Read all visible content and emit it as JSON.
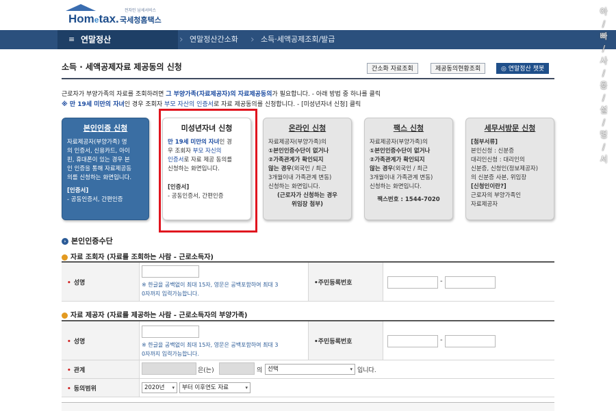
{
  "header": {
    "logo_brand": "Hom",
    "logo_e": "e",
    "logo_brand_end": "tax.",
    "logo_kr": "국세청홈택스",
    "logo_small": "전자민 남세서비스"
  },
  "nav": {
    "menu_icon": "≡",
    "main_label": "연말정산",
    "crumbs": [
      "연말정산간소화",
      "소득·세액공제조회/발급"
    ],
    "sep": "›"
  },
  "page": {
    "title": "소득 · 세액공제자료 제공동의 신청",
    "buttons": [
      "간소화 자료조회",
      "제공동의현황조회",
      "연말정산 챗봇"
    ],
    "intro1_a": "근로자가 부양가족의 자료를 조회하려면 ",
    "intro1_b": "그 부양가족(자료제공자)의 자료제공동의",
    "intro1_c": "가 필요합니다. - 아래 방법 중 하나를 클릭",
    "intro2_a": "※ 만 19세 미만의 자녀",
    "intro2_b": "인 경우 조회자 ",
    "intro2_c": "부모 자산의 인증서",
    "intro2_d": "로 자료 제공동의를 신청합니다. - [미성년자녀 신청] 클릭"
  },
  "cards": {
    "c1": {
      "title": "본인인증 신청",
      "lines": [
        "자료제공자(부양가족) 명",
        "의 인증서, 신용카드, 아이",
        "핀, 휴대폰이 있는 경우 본",
        "인 인증을 통해 자료제공동",
        "의를 신청하는 화면입니다."
      ],
      "sub": "[인증서]",
      "sub_line": "- 공동인증서, 간편인증"
    },
    "c2": {
      "title": "미성년자녀 신청",
      "l1a": "만 19세 미만의 자녀",
      "l1b": "인 경",
      "l2a": "우 조회자 ",
      "l2b": "부모 자신의",
      "l3a": "인증서",
      "l3b": "로 자료 제공 동의를",
      "l4": "신청하는 화면입니다.",
      "sub": "[인증서]",
      "sub_line": "- 공동인증서, 간편인증"
    },
    "c3": {
      "title": "온라인 신청",
      "l1": "자료제공자(부양가족)의",
      "l2": "①본인인증수단이 없거나",
      "l3": "②가족관계가 확인되지",
      "l4a": "않는 경우",
      "l4b": "(외국인 / 최근",
      "l5": "3개월이내 가족관계 변동)",
      "l6": "신청하는 화면입니다.",
      "l7": "(근로자가 신청하는 경우",
      "l8": "위임장 첨부)"
    },
    "c4": {
      "title": "팩스 신청",
      "l1": "자료제공자(부양가족)의",
      "l2": "①본인인증수단이 없거나",
      "l3": "②가족관계가 확인되지",
      "l4a": "않는 경우",
      "l4b": "(외국인 / 최근",
      "l5": "3개월이내 가족관계 변동)",
      "l6": "신청하는 화면입니다.",
      "fax": "팩스번호 : 1544-7020"
    },
    "c5": {
      "title": "세무서방문 신청",
      "sub1": "[첨부서류]",
      "l1": "본인신청 : 신분증",
      "l2": "대리인신청 : 대리인의",
      "l3": "신분증, 신청인(정보제공자)",
      "l4": "의 신분증 사본, 위임장",
      "sub2": "[신청인이란?]",
      "l5": "근로자의 부양가족인",
      "l6": "자료제공자"
    }
  },
  "section": {
    "title": "본인인증수단",
    "sub1": "자료 조회자 (자료를 조회하는 사람 - 근로소득자)",
    "sub2": "자료 제공자 (자료를 제공하는 사람 - 근로소득자의 부양가족)",
    "req": "•",
    "name_label": "성명",
    "rrn_label": "주민등록번호",
    "relation_label": "관계",
    "scope_label": "동의범위",
    "note_l1": "※ 한글을 공백없이 최대 15자, 영문은 공백포함하여 최대 3",
    "note_l2": "0자까지 입력가능합니다.",
    "dash": "-",
    "rel_eun": "은(는)",
    "rel_ui": "의",
    "rel_select": "선택",
    "rel_end": "입니다.",
    "year_select": "2020년",
    "scope_select": "부터 이후연도 자료",
    "arrow": "▾"
  },
  "side": {
    "chars": [
      "아",
      "/",
      "빠",
      "/",
      "사",
      "/",
      "용",
      "/",
      "설",
      "/",
      "명",
      "/",
      "서"
    ]
  }
}
